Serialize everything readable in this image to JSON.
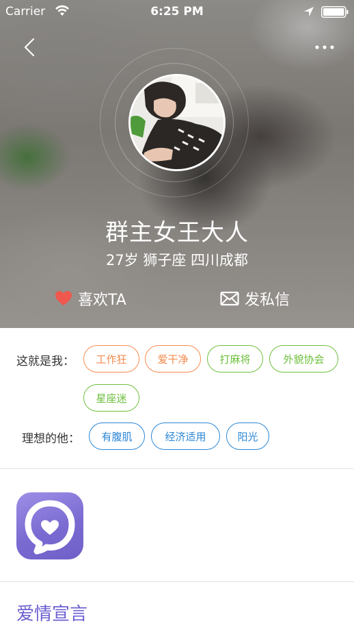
{
  "status_bar": {
    "carrier": "Carrier",
    "time": "6:25 PM"
  },
  "nav": {
    "back_icon": "chevron-left-icon",
    "more_icon": "ellipsis-icon"
  },
  "profile": {
    "name": "群主女王大人",
    "meta": "27岁 狮子座 四川成都",
    "avatar_icon": "user-avatar"
  },
  "actions": {
    "like_label": "喜欢TA",
    "like_icon": "heart-icon",
    "like_icon_color": "#f0574d",
    "message_label": "发私信",
    "message_icon": "envelope-icon"
  },
  "tags": {
    "self_label": "这就是我：",
    "self_tags": [
      {
        "label": "工作狂",
        "color": "#f58a4d"
      },
      {
        "label": "爱干净",
        "color": "#f58a4d"
      },
      {
        "label": "打麻将",
        "color": "#6cbf3b"
      },
      {
        "label": "外貌协会",
        "color": "#6cbf3b"
      },
      {
        "label": "星座迷",
        "color": "#6cbf3b"
      }
    ],
    "ideal_label": "理想的他：",
    "ideal_tags": [
      {
        "label": "有腹肌",
        "color": "#2b86d6"
      },
      {
        "label": "经济适用",
        "color": "#2b86d6"
      },
      {
        "label": "阳光",
        "color": "#2b86d6"
      }
    ]
  },
  "app": {
    "icon": "heart-chat-app-icon",
    "accent": "#7a6bd2"
  },
  "section": {
    "title": "爱情宣言"
  }
}
